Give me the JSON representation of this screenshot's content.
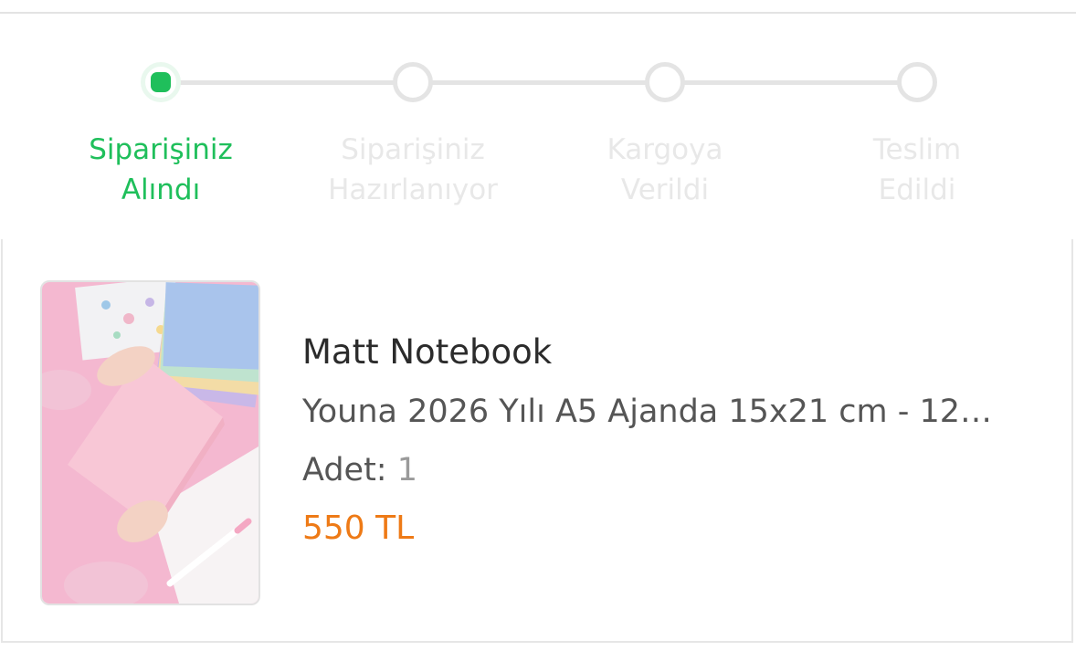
{
  "order_tracker": {
    "steps": [
      {
        "label_line1": "Siparişiniz",
        "label_line2": "Alındı",
        "state": "active"
      },
      {
        "label_line1": "Siparişiniz",
        "label_line2": "Hazırlanıyor",
        "state": "pending"
      },
      {
        "label_line1": "Kargoya",
        "label_line2": "Verildi",
        "state": "pending"
      },
      {
        "label_line1": "Teslim",
        "label_line2": "Edildi",
        "state": "pending"
      }
    ]
  },
  "product": {
    "brand": "Matt Notebook",
    "name": "Youna 2026 Yılı A5 Ajanda 15x21 cm - 12…",
    "quantity_label": "Adet:",
    "quantity_value": "1",
    "price": "550 TL",
    "image_alt": "pink notebook product photo"
  },
  "colors": {
    "active_green": "#1fbf5b",
    "inactive_gray": "#e4e4e4",
    "price_orange": "#ee7a16"
  }
}
